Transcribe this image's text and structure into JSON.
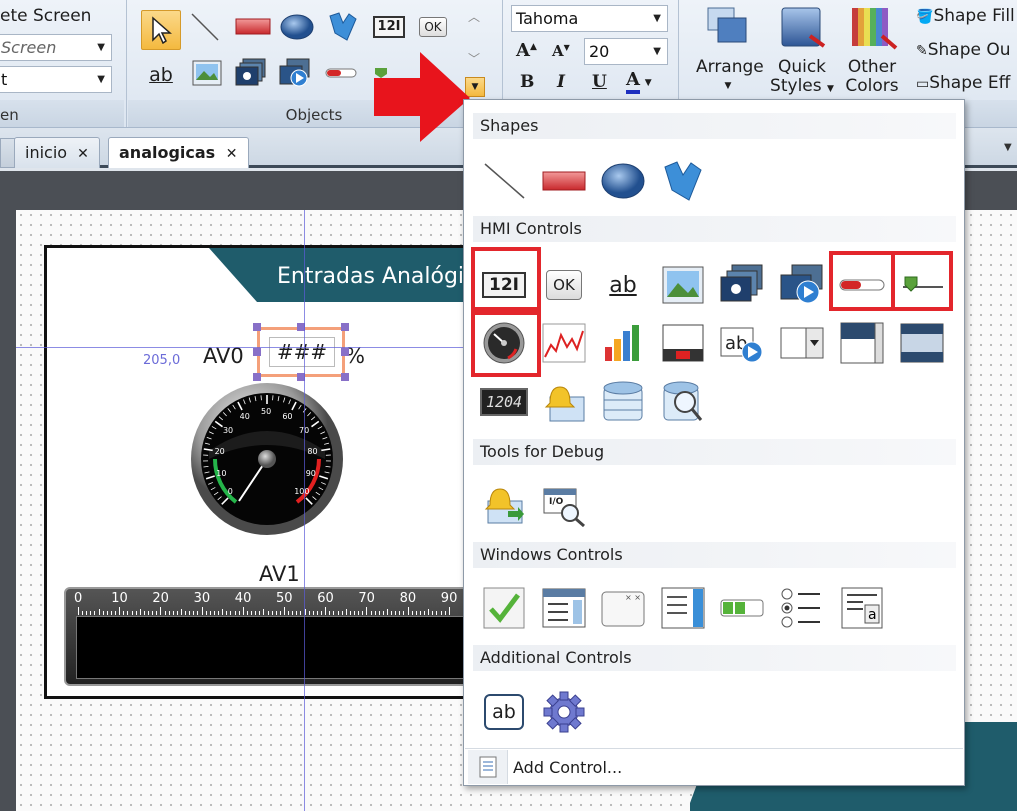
{
  "ribbon": {
    "screen_group": {
      "top_label": "ete Screen",
      "dropdown1": "Screen",
      "dropdown2": "t",
      "group_label": "en"
    },
    "objects_group": {
      "group_label": "Objects",
      "numeric_icon_text": "12I",
      "ok_icon_text": "OK"
    },
    "font_group": {
      "font_name": "Tahoma",
      "font_size": "20",
      "bold": "B",
      "italic": "I",
      "underline": "U",
      "font_color": "A"
    },
    "arrange_group": {
      "arrange": "Arrange",
      "quick_styles_1": "Quick",
      "quick_styles_2": "Styles",
      "other_colors_1": "Other",
      "other_colors_2": "Colors",
      "shape_fill": "Shape Fill",
      "shape_outline": "Shape Ou",
      "shape_effects": "Shape Eff"
    }
  },
  "tabs": [
    {
      "label": "inicio",
      "close": "✕"
    },
    {
      "label": "analogicas",
      "close": "✕"
    }
  ],
  "canvas": {
    "header_title": "Entradas Analógic",
    "coord_label": "205,0",
    "av0_label": "AV0",
    "numeric_value": "###",
    "unit": "%",
    "gauge_ticks": [
      "0",
      "10",
      "20",
      "30",
      "40",
      "50",
      "60",
      "70",
      "80",
      "90",
      "100"
    ],
    "av1_label": "AV1",
    "bar_ticks": [
      "0",
      "10",
      "20",
      "30",
      "40",
      "50",
      "60",
      "70",
      "80",
      "90"
    ]
  },
  "popup": {
    "sections": {
      "shapes": "Shapes",
      "hmi": "HMI Controls",
      "debug": "Tools for Debug",
      "windows": "Windows Controls",
      "additional": "Additional Controls"
    },
    "hmi_numeric_text": "12I",
    "hmi_ok_text": "OK",
    "hmi_text_label": "ab",
    "hmi_digital_text": "1204",
    "debug_io_text": "I/O",
    "additional_ab_text": "ab",
    "add_control": "Add Control..."
  },
  "colors": {
    "highlight": "#e3262c",
    "header_teal": "#1f5c6b",
    "selection": "#f4b93f",
    "arrow_red": "#e8141c"
  }
}
